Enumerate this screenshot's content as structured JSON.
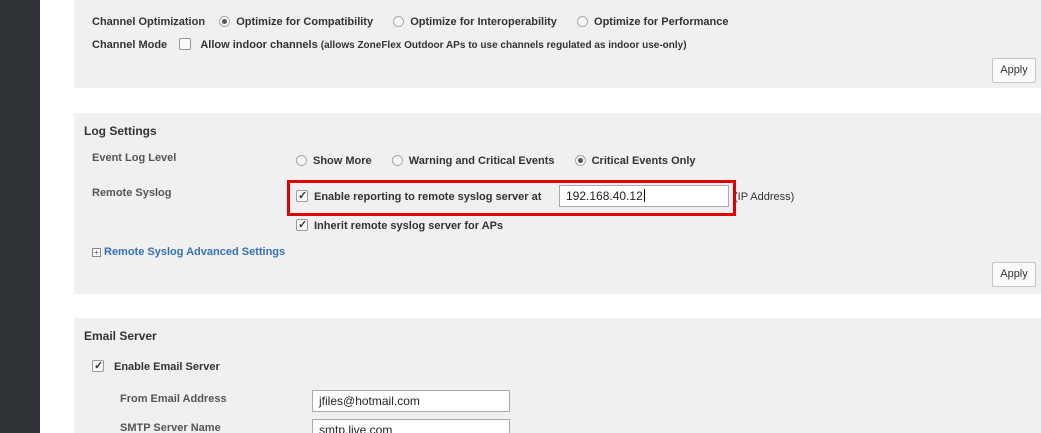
{
  "channel": {
    "optimization_label": "Channel Optimization",
    "options": [
      {
        "label": "Optimize for Compatibility",
        "selected": true
      },
      {
        "label": "Optimize for Interoperability",
        "selected": false
      },
      {
        "label": "Optimize for Performance",
        "selected": false
      }
    ],
    "mode_label": "Channel Mode",
    "indoor_label": "Allow indoor channels",
    "indoor_note": "(allows ZoneFlex Outdoor APs to use channels regulated as indoor use-only)",
    "indoor_checked": false,
    "apply_label": "Apply"
  },
  "log": {
    "heading": "Log Settings",
    "event_level_label": "Event Log Level",
    "levels": [
      {
        "label": "Show More",
        "selected": false
      },
      {
        "label": "Warning and Critical Events",
        "selected": false
      },
      {
        "label": "Critical Events Only",
        "selected": true
      }
    ],
    "remote_syslog_label": "Remote Syslog",
    "enable_label": "Enable reporting to remote syslog server at",
    "enable_checked": true,
    "server_ip": "192.168.40.12",
    "ip_suffix": "(IP Address)",
    "inherit_label": "Inherit remote syslog server for APs",
    "inherit_checked": true,
    "advanced_expander": "+",
    "advanced_label": "Remote Syslog Advanced Settings",
    "apply_label": "Apply"
  },
  "email": {
    "heading": "Email Server",
    "enable_label": "Enable Email Server",
    "enable_checked": true,
    "from_label": "From Email Address",
    "from_value": "jfiles@hotmail.com",
    "smtp_label": "SMTP Server Name",
    "smtp_value": "smtp.live.com"
  },
  "colors": {
    "highlight": "#e00000",
    "link": "#3571b8",
    "sidebar": "#2f3236",
    "panel": "#f0f0f0"
  }
}
